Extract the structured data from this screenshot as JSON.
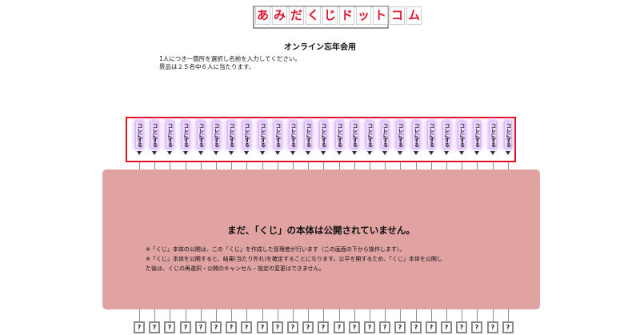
{
  "logo": {
    "chars": [
      "あ",
      "み",
      "だ",
      "く",
      "じ",
      "ド",
      "ッ",
      "ト",
      "コ",
      "ム"
    ]
  },
  "event_title": "オンライン忘年会用",
  "instructions": [
    "1人につき一箇所を選択し名前を入力してください。",
    "景品は２５名中６人に当たります。"
  ],
  "choices": {
    "count": 25,
    "label": "コレにする"
  },
  "panel": {
    "message": "まだ、「くじ」の本体は公開されていません。",
    "notes": [
      "※「くじ」本体の公開は、この「くじ」を作成した管理者が行います（この画面の下から操作します）。",
      "※「くじ」本体を公開すると、結果(当たり外れ)を確定することになります。公平を期するため、「くじ」本体を公開し",
      "た後は、くじの再選択・公開のキャンセル・設定の変更はできません。"
    ]
  },
  "results": {
    "count": 25,
    "mark": "?"
  },
  "colors": {
    "accent_red": "#e3101e",
    "logo_red": "#e0142d",
    "panel_pink": "#e1a2a2",
    "button_glow": "#d9b0ff"
  }
}
